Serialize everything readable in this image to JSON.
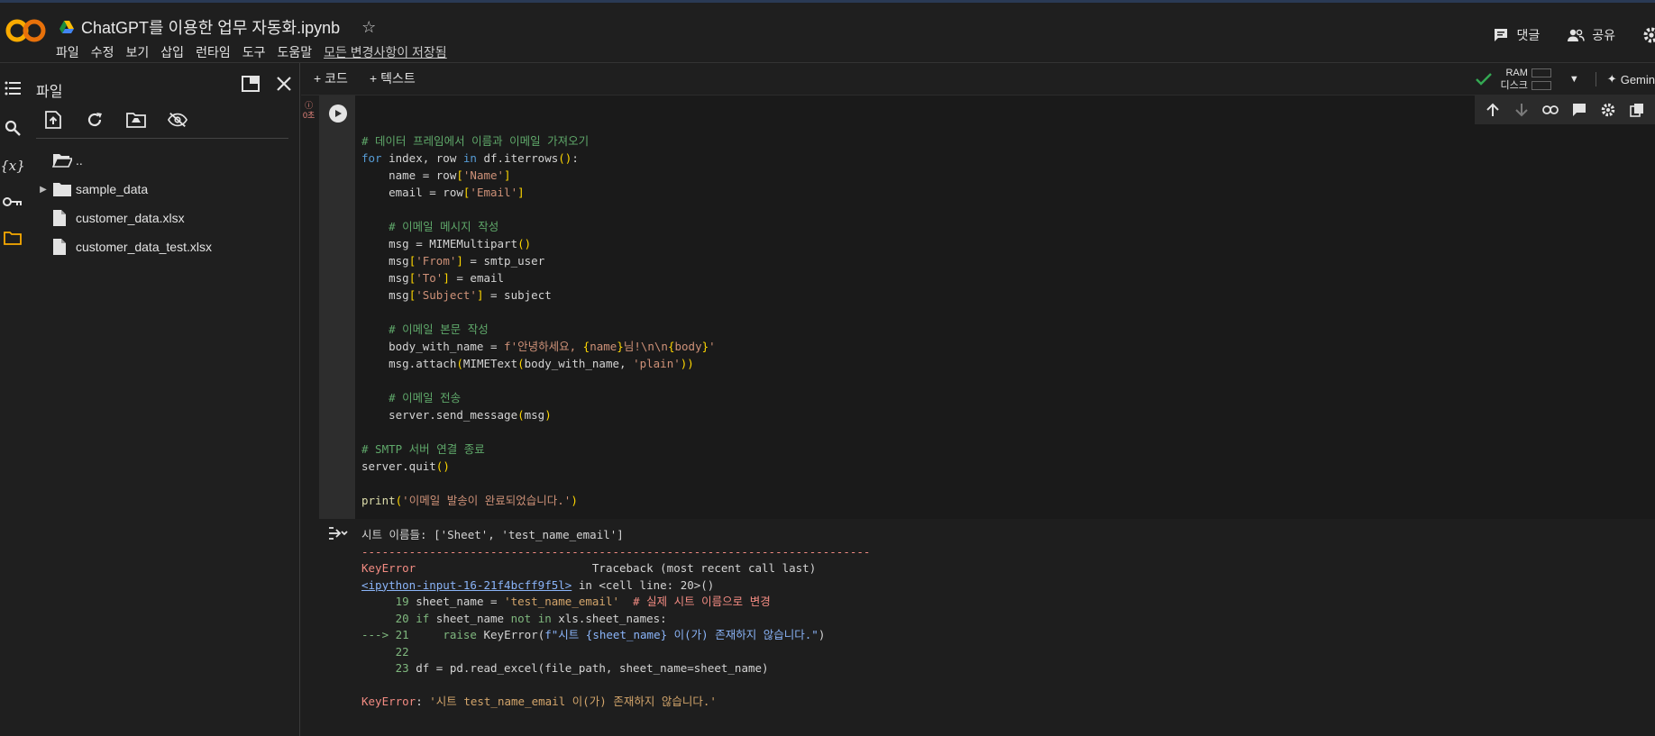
{
  "header": {
    "title": "ChatGPT를 이용한 업무 자동화.ipynb",
    "menu": [
      "파일",
      "수정",
      "보기",
      "삽입",
      "런타임",
      "도구",
      "도움말"
    ],
    "saved_status": "모든 변경사항이 저장됨",
    "comment_label": "댓글",
    "share_label": "공유"
  },
  "file_panel": {
    "title": "파일",
    "items": [
      {
        "label": "..",
        "type": "folder-up"
      },
      {
        "label": "sample_data",
        "type": "folder"
      },
      {
        "label": "customer_data.xlsx",
        "type": "file"
      },
      {
        "label": "customer_data_test.xlsx",
        "type": "file"
      }
    ]
  },
  "notebook_toolbar": {
    "add_code": "+ 코드",
    "add_text": "+ 텍스트",
    "ram_label": "RAM",
    "disk_label": "디스크",
    "gemini_label": "Gemin"
  },
  "cell": {
    "exec_time": "0초",
    "code_lines": [
      "",
      "# 데이터 프레임에서 이름과 이메일 가져오기",
      "for index, row in df.iterrows():",
      "    name = row['Name']",
      "    email = row['Email']",
      "",
      "    # 이메일 메시지 작성",
      "    msg = MIMEMultipart()",
      "    msg['From'] = smtp_user",
      "    msg['To'] = email",
      "    msg['Subject'] = subject",
      "",
      "    # 이메일 본문 작성",
      "    body_with_name = f'안녕하세요, {name}님!\\n\\n{body}'",
      "    msg.attach(MIMEText(body_with_name, 'plain'))",
      "",
      "    # 이메일 전송",
      "    server.send_message(msg)",
      "",
      "# SMTP 서버 연결 종료",
      "server.quit()",
      "",
      "print('이메일 발송이 완료되었습니다.')"
    ]
  },
  "output": {
    "sheet_names": "시트 이름들: ['Sheet', 'test_name_email']",
    "divider": "---------------------------------------------------------------------------",
    "error_type": "KeyError",
    "traceback_label": "Traceback (most recent call last)",
    "link": "<ipython-input-16-21f4bcff9f5l>",
    "in_cell": " in <cell line: 20>()",
    "tb_lines": [
      {
        "prefix": "     19 ",
        "code": "sheet_name = 'test_name_email'  # 실제 시트 이름으로 변경"
      },
      {
        "prefix": "     20 ",
        "code": "if sheet_name not in xls.sheet_names:"
      },
      {
        "prefix": "---> 21 ",
        "code": "    raise KeyError(f\"시트 {sheet_name} 이(가) 존재하지 않습니다.\")"
      },
      {
        "prefix": "     22 ",
        "code": ""
      },
      {
        "prefix": "     23 ",
        "code": "df = pd.read_excel(file_path, sheet_name=sheet_name)"
      }
    ],
    "final_error": "KeyError: '시트 test_name_email 이(가) 존재하지 않습니다.'"
  }
}
